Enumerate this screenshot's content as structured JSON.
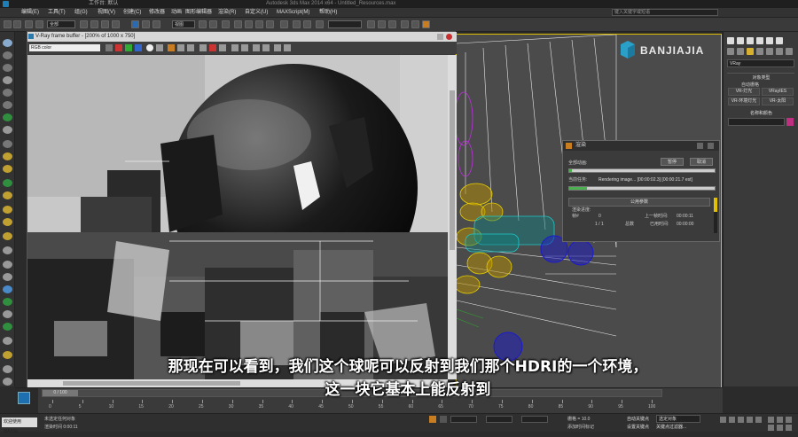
{
  "window": {
    "title": "工作台: 默认",
    "center_title": "Autodesk 3ds Max 2014 x64 - Untitled_Resources.max"
  },
  "search": {
    "placeholder": "键入关键字或短语"
  },
  "menu": [
    "编辑(E)",
    "工具(T)",
    "组(G)",
    "视图(V)",
    "创建(C)",
    "修改器",
    "动画",
    "图形编辑器",
    "渲染(R)",
    "自定义(U)",
    "MAXScript(M)",
    "帮助(H)"
  ],
  "toolbar": {
    "filter_select": "全部",
    "view_select": "视图"
  },
  "vfb": {
    "title": "V-Ray frame buffer - [200% of 1000 x 750]",
    "channel": "RGB color"
  },
  "logo": {
    "text": "BANJIAJIA"
  },
  "right_panel": {
    "renderer": "VRay",
    "section_object_type": "对象类型",
    "auto_grid": "自动栅格",
    "btn_light": "VR-灯光",
    "btn_ies": "VRayIES",
    "btn_env_light": "VR-环境灯光",
    "btn_sun": "VR-太阳",
    "section_name_color": "名称和颜色"
  },
  "render_dialog": {
    "title": "渲染",
    "total_label": "全部动画:",
    "pause": "暂停",
    "cancel": "取消",
    "current_task_label": "当前任务:",
    "current_task": "Rendering image... [00:00:02.3] [00:00:21.7 est]",
    "params_header": "公用参数",
    "progress_label": "渲染进度:",
    "frame_label": "帧#",
    "frame_value": "0",
    "last_frame_label": "上一帧时间:",
    "last_frame_value": "00:00:11",
    "frame_of": "1 / 1",
    "total_text": "总数",
    "elapsed_label": "已用时间:",
    "elapsed_value": "00:00:00",
    "current_progress": 0.12,
    "total_progress": 0.02
  },
  "timeline": {
    "frame_display": "0 / 100",
    "ticks": [
      "0",
      "5",
      "10",
      "15",
      "20",
      "25",
      "30",
      "35",
      "40",
      "45",
      "50",
      "55",
      "60",
      "65",
      "70",
      "75",
      "80",
      "85",
      "90",
      "95",
      "100"
    ]
  },
  "status": {
    "welcome": "欢迎使用 MAXSc",
    "selection": "未选定任何对象",
    "render_time": "渲染时间  0:00:11",
    "grid": "栅格 = 10.0",
    "add_time_tag": "添加时间标记",
    "autokey": "自动关键点",
    "setkey": "设置关键点",
    "select_obj": "选定对象",
    "key_filter": "关键点过滤器..."
  },
  "subtitle": {
    "line1": "那现在可以看到，我们这个球呢可以反射到我们那个HDRI的一个环境，",
    "line2": "这一块它基本上能反射到"
  },
  "colors": {
    "accent_yellow": "#e0c000",
    "wire_blue": "#1a1ad0",
    "wire_yellow": "#e8d000",
    "wire_cyan": "#20c8c8"
  }
}
